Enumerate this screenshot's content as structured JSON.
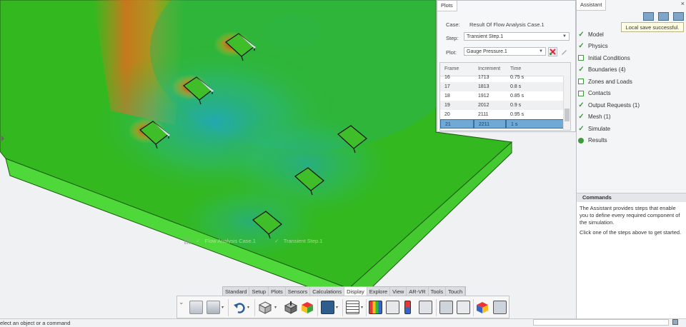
{
  "viewport": {
    "labels": {
      "case": "Flow Analysis Case.1",
      "step": "Transient Step.1"
    }
  },
  "plots_panel": {
    "tab": "Plots",
    "case_label": "Case:",
    "case_value": "Result Of Flow Analysis Case.1",
    "step_label": "Step:",
    "step_value": "Transient Step.1",
    "plot_label": "Plot:",
    "plot_value": "Gauge Pressure.1",
    "table": {
      "headers": [
        "Frame",
        "Increment",
        "Time"
      ],
      "rows": [
        [
          "16",
          "1713",
          "0.75 s"
        ],
        [
          "17",
          "1813",
          "0.8 s"
        ],
        [
          "18",
          "1912",
          "0.85 s"
        ],
        [
          "19",
          "2012",
          "0.9 s"
        ],
        [
          "20",
          "2111",
          "0.95 s"
        ],
        [
          "21",
          "2211",
          "1 s"
        ]
      ],
      "selected_frame": "21"
    }
  },
  "assistant": {
    "tab": "Assistant",
    "close": "×",
    "tooltip": "Local save successful.",
    "steps": [
      {
        "label": "Model",
        "icon": "check-icon"
      },
      {
        "label": "Physics",
        "icon": "check-icon"
      },
      {
        "label": "Initial Conditions",
        "icon": "checkbox-icon"
      },
      {
        "label": "Boundaries (4)",
        "icon": "check-icon"
      },
      {
        "label": "Zones and Loads",
        "icon": "checkbox-icon"
      },
      {
        "label": "Contacts",
        "icon": "checkbox-icon"
      },
      {
        "label": "Output Requests (1)",
        "icon": "check-icon"
      },
      {
        "label": "Mesh (1)",
        "icon": "check-icon"
      },
      {
        "label": "Simulate",
        "icon": "check-icon"
      },
      {
        "label": "Results",
        "icon": "status-dot-icon"
      }
    ],
    "commands": {
      "title": "Commands",
      "text1": "The Assistant provides steps that enable you to define every required component of the simulation.",
      "text2": "Click one of the steps above to get started."
    }
  },
  "ribbon": {
    "tabs": [
      "Standard",
      "Setup",
      "Plots",
      "Sensors",
      "Calculations",
      "Display",
      "Explore",
      "View",
      "AR-VR",
      "Tools",
      "Touch"
    ],
    "active_tab": "Display"
  },
  "status": {
    "prompt": "elect an object or a command"
  },
  "colors": {
    "accent": "#3d9a3a",
    "selection": "#6fa9d6",
    "plate_top": "#33b81f",
    "plate_side": "#4fd83a"
  }
}
